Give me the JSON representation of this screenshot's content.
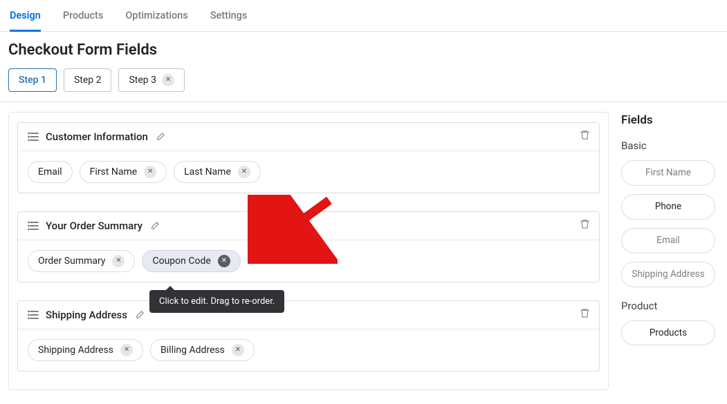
{
  "topnav": {
    "tabs": [
      "Design",
      "Products",
      "Optimizations",
      "Settings"
    ],
    "activeIndex": 0
  },
  "pageTitle": "Checkout Form Fields",
  "steps": [
    {
      "label": "Step 1",
      "active": true,
      "removable": false
    },
    {
      "label": "Step 2",
      "active": false,
      "removable": false
    },
    {
      "label": "Step 3",
      "active": false,
      "removable": true
    }
  ],
  "sections": [
    {
      "title": "Customer Information",
      "fields": [
        {
          "label": "Email",
          "removable": false,
          "hover": false
        },
        {
          "label": "First Name",
          "removable": true,
          "hover": false
        },
        {
          "label": "Last Name",
          "removable": true,
          "hover": false
        }
      ]
    },
    {
      "title": "Your Order Summary",
      "fields": [
        {
          "label": "Order Summary",
          "removable": true,
          "hover": false
        },
        {
          "label": "Coupon Code",
          "removable": true,
          "hover": true
        }
      ]
    },
    {
      "title": "Shipping Address",
      "fields": [
        {
          "label": "Shipping Address",
          "removable": true,
          "hover": false
        },
        {
          "label": "Billing Address",
          "removable": true,
          "hover": false
        }
      ]
    }
  ],
  "tooltip": "Click to edit. Drag to re-order.",
  "sidebar": {
    "heading": "Fields",
    "groups": [
      {
        "label": "Basic",
        "items": [
          {
            "label": "First Name",
            "active": false
          },
          {
            "label": "Phone",
            "active": true
          },
          {
            "label": "Email",
            "active": false
          },
          {
            "label": "Shipping Address",
            "active": false
          }
        ]
      },
      {
        "label": "Product",
        "items": [
          {
            "label": "Products",
            "active": true
          }
        ]
      }
    ]
  },
  "icons": {
    "close": "✕"
  }
}
